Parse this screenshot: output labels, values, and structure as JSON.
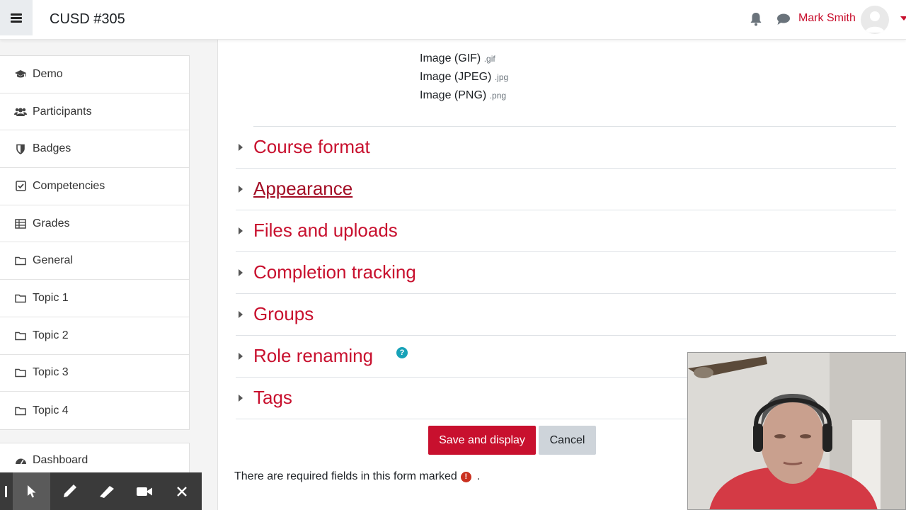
{
  "header": {
    "site_name": "CUSD #305",
    "user_name": "Mark Smith"
  },
  "sidebar": {
    "items": [
      {
        "label": "Demo",
        "icon": "graduation-cap-icon"
      },
      {
        "label": "Participants",
        "icon": "users-icon"
      },
      {
        "label": "Badges",
        "icon": "shield-icon"
      },
      {
        "label": "Competencies",
        "icon": "check-square-icon"
      },
      {
        "label": "Grades",
        "icon": "table-icon"
      },
      {
        "label": "General",
        "icon": "folder-icon"
      },
      {
        "label": "Topic 1",
        "icon": "folder-icon"
      },
      {
        "label": "Topic 2",
        "icon": "folder-icon"
      },
      {
        "label": "Topic 3",
        "icon": "folder-icon"
      },
      {
        "label": "Topic 4",
        "icon": "folder-icon"
      }
    ],
    "dashboard": {
      "label": "Dashboard",
      "icon": "tachometer-icon"
    }
  },
  "filetypes": [
    {
      "name": "Image (GIF)",
      "ext": ".gif"
    },
    {
      "name": "Image (JPEG)",
      "ext": ".jpg"
    },
    {
      "name": "Image (PNG)",
      "ext": ".png"
    }
  ],
  "sections": [
    {
      "title": "Course format"
    },
    {
      "title": "Appearance"
    },
    {
      "title": "Files and uploads"
    },
    {
      "title": "Completion tracking"
    },
    {
      "title": "Groups"
    },
    {
      "title": "Role renaming"
    },
    {
      "title": "Tags"
    }
  ],
  "help_icon_glyph": "?",
  "buttons": {
    "save": "Save and display",
    "cancel": "Cancel"
  },
  "required_note": {
    "text": "There are required fields in this form marked",
    "icon_glyph": "!",
    "suffix": "."
  },
  "colors": {
    "brand": "#c8102e",
    "help": "#17a2b8",
    "required": "#ca3120"
  }
}
